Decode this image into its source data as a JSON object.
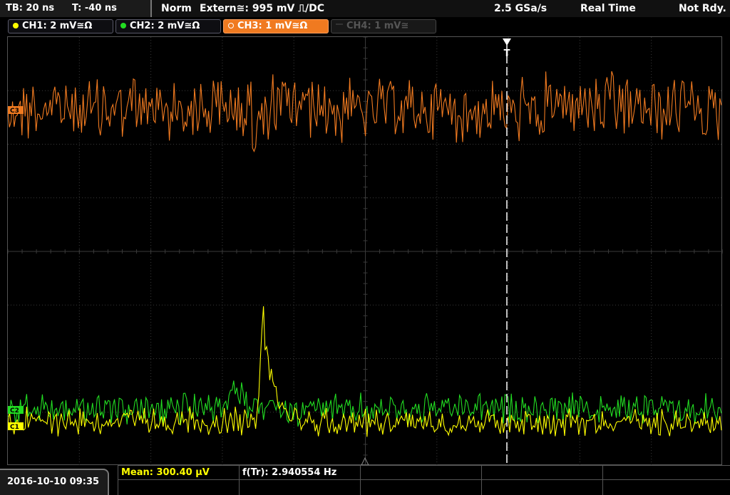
{
  "timebase": {
    "tb_label": "TB: 20 ns",
    "trig_pos_label": "T: -40 ns"
  },
  "status": {
    "trigger_mode": "Norm",
    "trigger_source": "Extern≅: 995 mV ⎍/DC",
    "sample_rate": "2.5 GSa/s",
    "acq_mode": "Real Time",
    "state": "Not Rdy."
  },
  "channels": [
    {
      "label": "CH1: 2 mV≅Ω",
      "color": "#ffff00",
      "active": true
    },
    {
      "label": "CH2: 2 mV≅Ω",
      "color": "#22dd22",
      "active": true
    },
    {
      "label": "CH3: 1 mV≅Ω",
      "color": "#f07a20",
      "active": true,
      "selected": true
    },
    {
      "label": "CH4: 1 mV≅",
      "color": "#555555",
      "active": false
    }
  ],
  "markers": {
    "ch3": "C3",
    "ch2": "C2",
    "ch1": "C1",
    "trigger": "T"
  },
  "datetime": "2016-10-10 09:35",
  "measurements": [
    {
      "label": "Mean: 300.40 µV",
      "color": "#ffff00"
    },
    {
      "label": "f(Tr): 2.940554 Hz",
      "color": "#ffffff"
    }
  ]
}
